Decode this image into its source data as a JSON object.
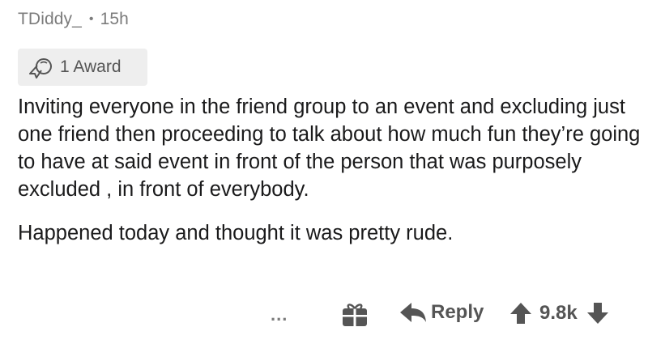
{
  "comment": {
    "author": "TDiddy_",
    "separator": "•",
    "age": "15h",
    "award": {
      "label": "1 Award",
      "icon": "award-ribbon-icon"
    },
    "body": [
      "Inviting everyone in the friend group to an event and excluding just one friend then proceeding to talk about how much fun they’re going to have at said event in front of the person that was purposely excluded , in front of everybody.",
      "Happened today and thought it was pretty rude."
    ],
    "actions": {
      "more": "...",
      "gift_icon": "gift-icon",
      "reply_label": "Reply",
      "score": "9.8k"
    }
  },
  "colors": {
    "text": "#1a1a1b",
    "muted": "#7c7c7c",
    "action": "#555555",
    "award_bg": "#eeeeee"
  }
}
